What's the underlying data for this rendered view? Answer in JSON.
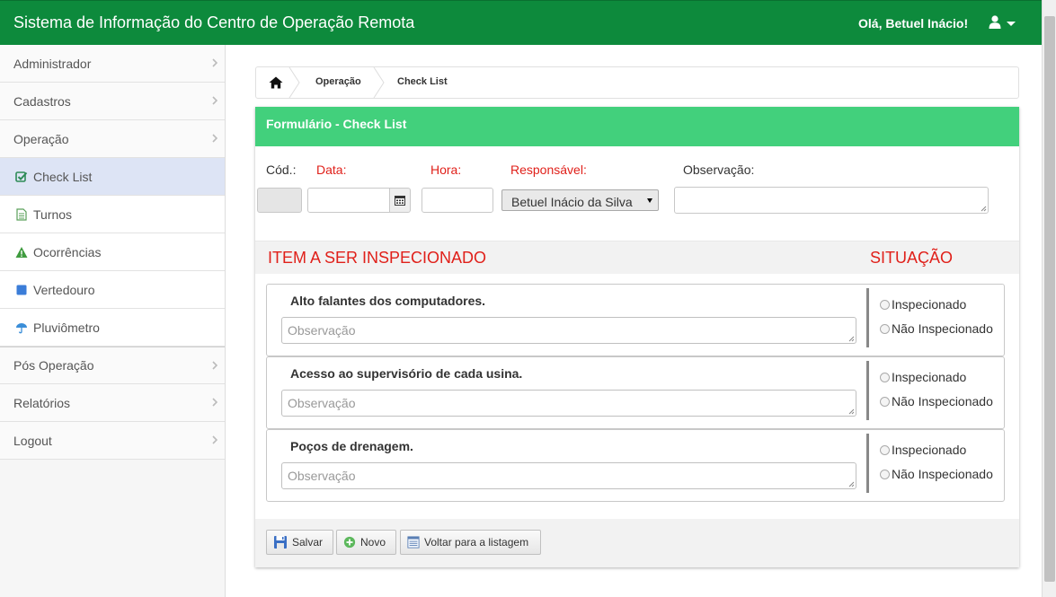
{
  "header": {
    "title": "Sistema de Informação do Centro de Operação Remota",
    "greeting": "Olá, Betuel Inácio!",
    "user_icon": "user-icon"
  },
  "sidebar": {
    "items": [
      {
        "label": "Administrador"
      },
      {
        "label": "Cadastros"
      },
      {
        "label": "Operação"
      },
      {
        "label": "Check List",
        "icon": "check-square-icon"
      },
      {
        "label": "Turnos",
        "icon": "document-icon"
      },
      {
        "label": "Ocorrências",
        "icon": "warning-icon"
      },
      {
        "label": "Vertedouro",
        "icon": "square-icon"
      },
      {
        "label": "Pluviômetro",
        "icon": "umbrella-icon"
      },
      {
        "label": "Pós Operação"
      },
      {
        "label": "Relatórios"
      },
      {
        "label": "Logout"
      }
    ]
  },
  "breadcrumb": {
    "items": [
      "Operação",
      "Check List"
    ]
  },
  "form": {
    "title": "Formulário - Check List",
    "labels": {
      "cod": "Cód.:",
      "data": "Data:",
      "hora": "Hora:",
      "responsavel": "Responsável:",
      "observacao": "Observação:"
    },
    "responsavel_value": "Betuel Inácio da Silva",
    "section_item": "ITEM A SER INSPECIONADO",
    "section_status": "SITUAÇÃO",
    "observacao_placeholder": "Observação",
    "radio_inspecionado": "Inspecionado",
    "radio_nao_inspecionado": "Não Inspecionado",
    "items": [
      {
        "name": "Alto falantes dos computadores."
      },
      {
        "name": "Acesso ao supervisório de cada usina."
      },
      {
        "name": "Poços de drenagem."
      }
    ]
  },
  "buttons": {
    "salvar": "Salvar",
    "novo": "Novo",
    "voltar": "Voltar para a listagem"
  },
  "colors": {
    "topbar": "#0d8a3c",
    "panel_header": "#42d07c",
    "required_label": "#e0201a",
    "active_menu": "#dde4f5"
  }
}
